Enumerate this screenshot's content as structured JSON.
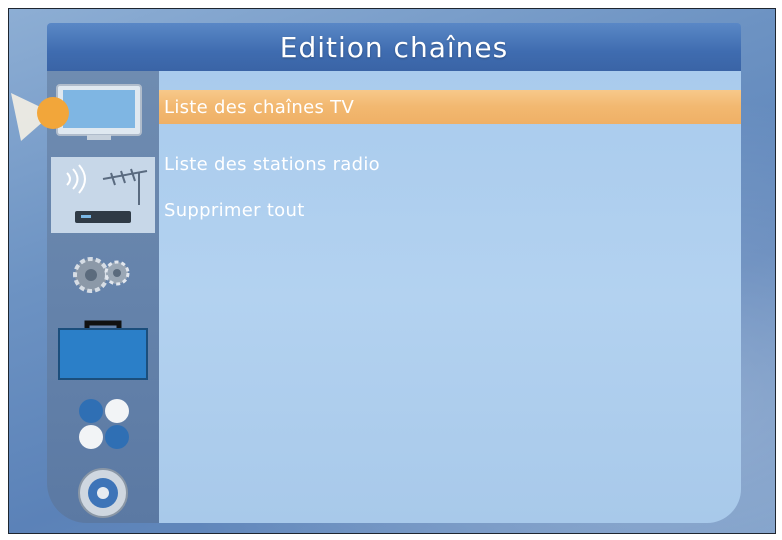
{
  "header": {
    "title": "Edition chaînes"
  },
  "sidebar": {
    "icons": [
      {
        "name": "tv-icon",
        "selected": true
      },
      {
        "name": "antenna-receiver-icon"
      },
      {
        "name": "gears-icon"
      },
      {
        "name": "toolbox-icon"
      },
      {
        "name": "colored-balls-icon"
      },
      {
        "name": "disc-icon"
      }
    ]
  },
  "menu": {
    "items": [
      {
        "label": "Liste des chaînes TV",
        "selected": true
      },
      {
        "label": "Liste des stations radio",
        "selected": false
      },
      {
        "label": "Supprimer tout",
        "selected": false
      }
    ]
  },
  "colors": {
    "highlight": "#f2b870",
    "panel": "#aecdee",
    "title_bar": "#3f6cb0",
    "text": "#ffffff"
  }
}
